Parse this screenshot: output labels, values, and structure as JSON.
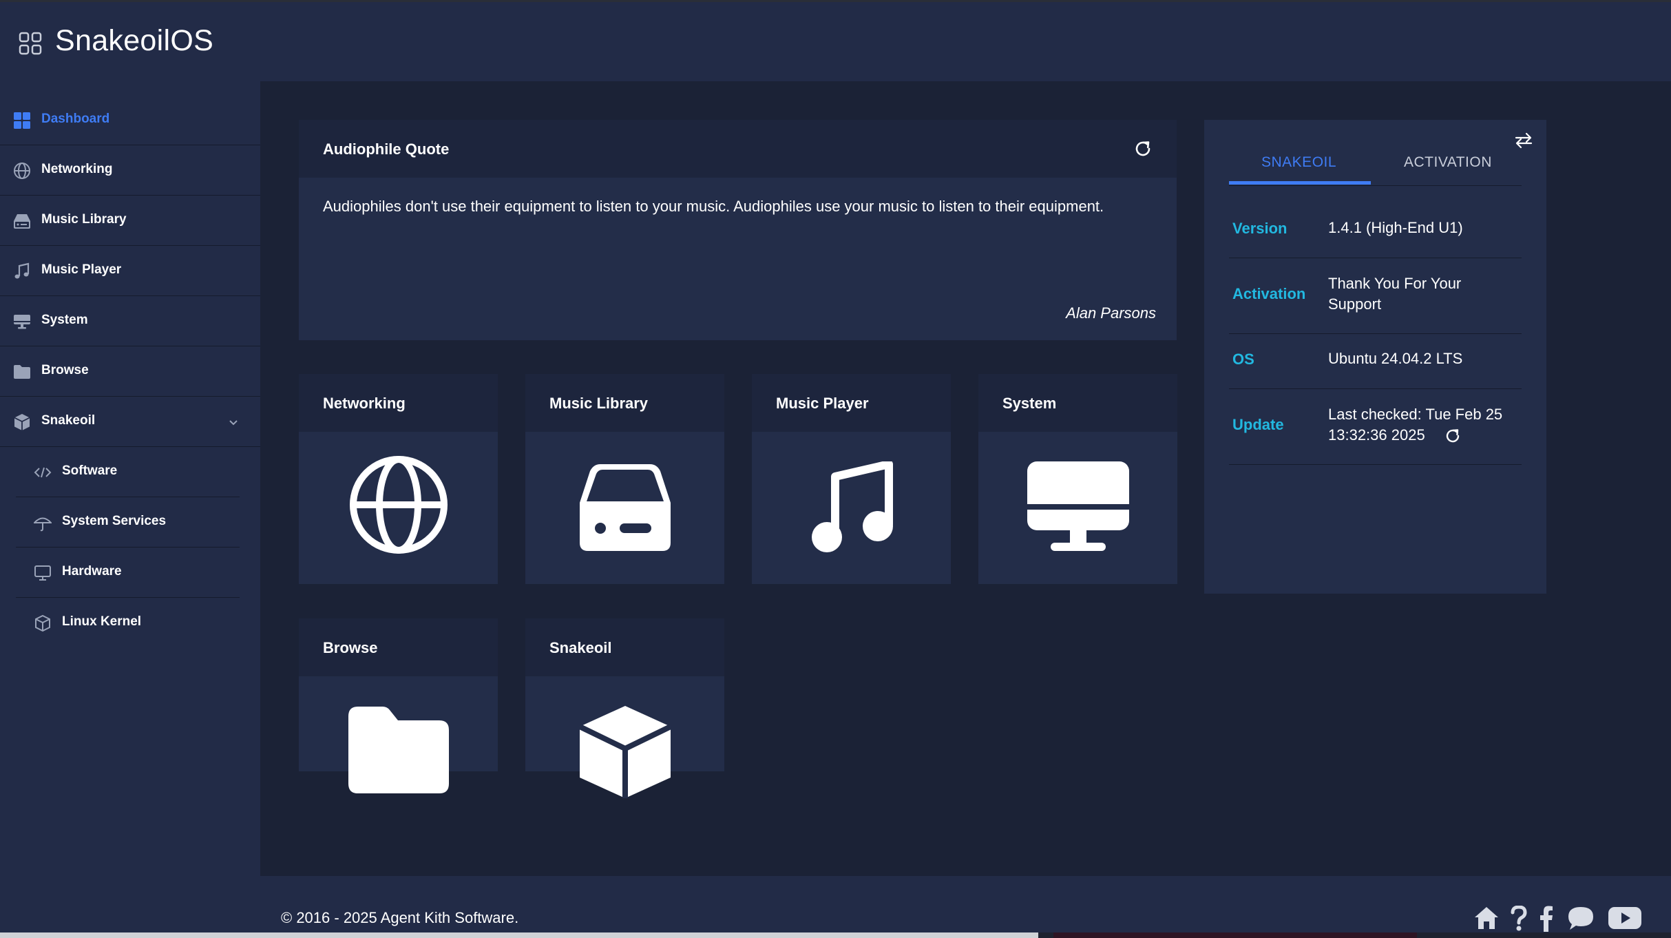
{
  "app": {
    "title": "SnakeoilOS"
  },
  "colors": {
    "accent": "#3f7cf4",
    "key": "#22b8e0",
    "bg": "#1b2236",
    "panel": "#232d49"
  },
  "sidebar": {
    "items": [
      {
        "label": "Dashboard",
        "icon": "dashboard-grid-icon",
        "active": true
      },
      {
        "label": "Networking",
        "icon": "globe-icon"
      },
      {
        "label": "Music Library",
        "icon": "hard-drive-icon"
      },
      {
        "label": "Music Player",
        "icon": "music-note-icon"
      },
      {
        "label": "System",
        "icon": "monitor-icon"
      },
      {
        "label": "Browse",
        "icon": "folder-icon"
      },
      {
        "label": "Snakeoil",
        "icon": "box-icon",
        "expanded": true
      }
    ],
    "subitems": [
      {
        "label": "Software",
        "icon": "code-icon"
      },
      {
        "label": "System Services",
        "icon": "umbrella-icon"
      },
      {
        "label": "Hardware",
        "icon": "desktop-icon"
      },
      {
        "label": "Linux Kernel",
        "icon": "cube-outline-icon"
      }
    ]
  },
  "quote": {
    "title": "Audiophile Quote",
    "text": "Audiophiles don't use their equipment to listen to your music. Audiophiles use your music to listen to their equipment.",
    "author": "Alan Parsons"
  },
  "tiles": [
    {
      "label": "Networking",
      "icon": "globe-icon"
    },
    {
      "label": "Music Library",
      "icon": "hard-drive-icon"
    },
    {
      "label": "Music Player",
      "icon": "music-note-icon"
    },
    {
      "label": "System",
      "icon": "monitor-icon"
    },
    {
      "label": "Browse",
      "icon": "folder-icon"
    },
    {
      "label": "Snakeoil",
      "icon": "box-icon"
    }
  ],
  "info": {
    "tabs": [
      "SNAKEOIL",
      "ACTIVATION"
    ],
    "active_tab": "SNAKEOIL",
    "rows": [
      {
        "key": "Version",
        "value": "1.4.1 (High-End U1)"
      },
      {
        "key": "Activation",
        "value": "Thank You For Your Support"
      },
      {
        "key": "OS",
        "value": "Ubuntu 24.04.2 LTS"
      },
      {
        "key": "Update",
        "value": "Last checked: Tue Feb 25 13:32:36 2025"
      }
    ]
  },
  "footer": {
    "copyright": "© 2016 - 2025 Agent Kith Software.",
    "icons": [
      "home-icon",
      "help-icon",
      "facebook-icon",
      "chat-icon",
      "youtube-icon"
    ]
  }
}
